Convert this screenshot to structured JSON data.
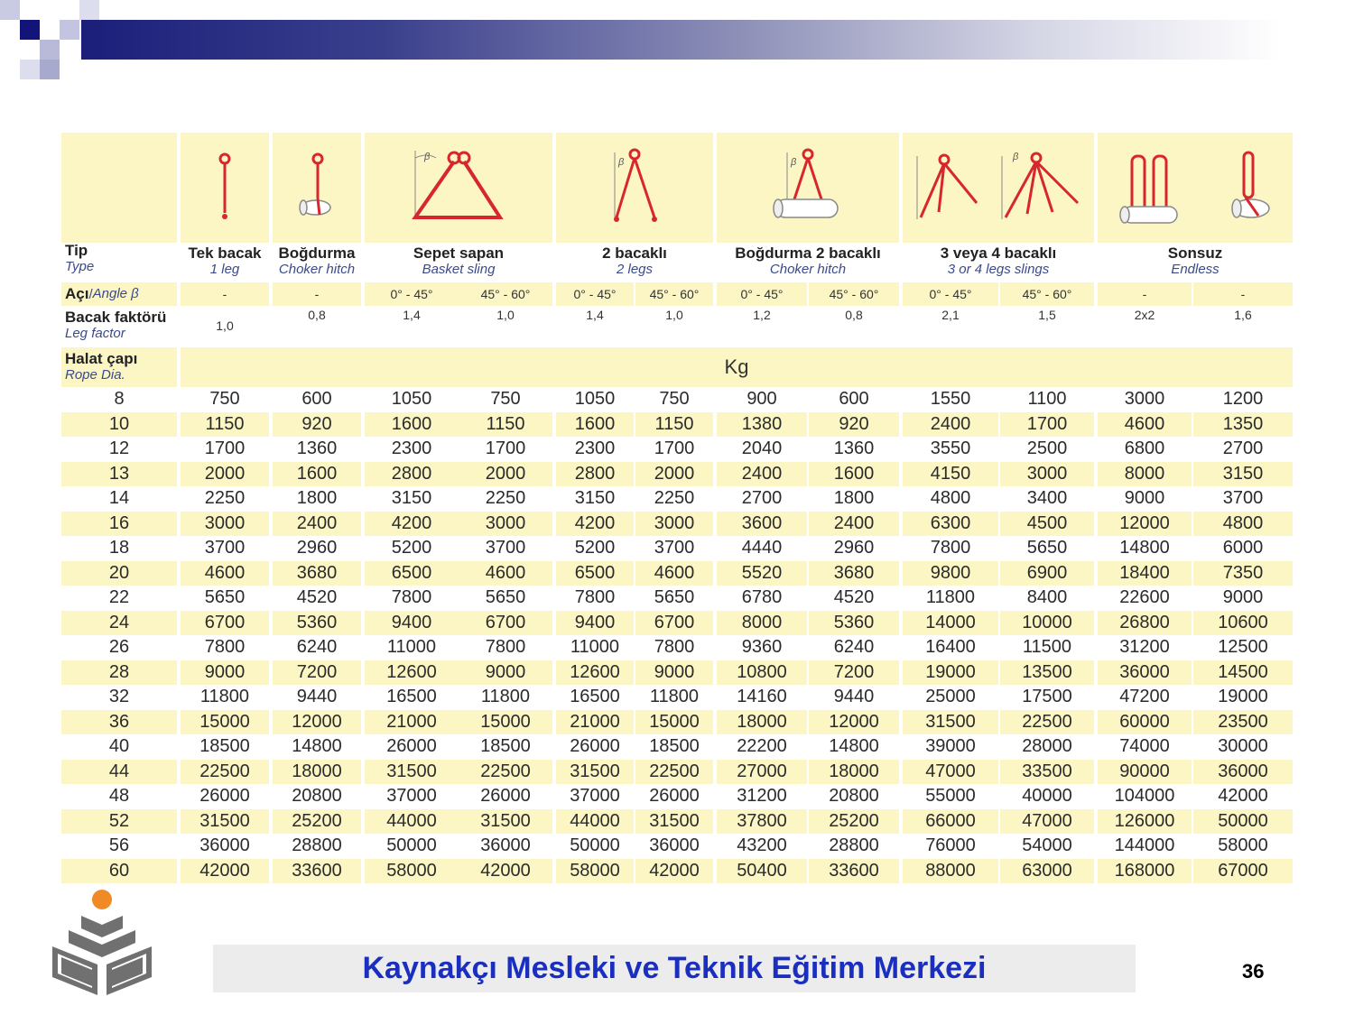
{
  "header": {
    "col_type": {
      "tr": "Tip",
      "en": "Type"
    },
    "angle_label": {
      "tr": "Açı",
      "en": "Angle β"
    },
    "leg_factor": {
      "tr": "Bacak faktörü",
      "en": "Leg factor"
    },
    "rope_dia": {
      "tr": "Halat çapı",
      "en": "Rope Dia."
    },
    "unit": "Kg",
    "groups": [
      {
        "tr": "Tek bacak",
        "en": "1 leg"
      },
      {
        "tr": "Boğdurma",
        "en": "Choker hitch"
      },
      {
        "tr": "Sepet sapan",
        "en": "Basket sling"
      },
      {
        "tr": "2 bacaklı",
        "en": "2 legs"
      },
      {
        "tr": "Boğdurma 2 bacaklı",
        "en": "Choker hitch"
      },
      {
        "tr": "3 veya 4 bacaklı",
        "en": "3 or 4 legs slings"
      },
      {
        "tr": "Sonsuz",
        "en": "Endless"
      }
    ],
    "angles": [
      "-",
      "-",
      "0° - 45°",
      "45° - 60°",
      "0° - 45°",
      "45° - 60°",
      "0° - 45°",
      "45° - 60°",
      "0° - 45°",
      "45° - 60°",
      "-",
      "-"
    ],
    "factors": [
      "1,0",
      "0,8",
      "1,4",
      "1,0",
      "1,4",
      "1,0",
      "1,2",
      "0,8",
      "2,1",
      "1,5",
      "2x2",
      "1,6"
    ],
    "beta_symbol": "β"
  },
  "rows": [
    [
      "8",
      "750",
      "600",
      "1050",
      "750",
      "1050",
      "750",
      "900",
      "600",
      "1550",
      "1100",
      "3000",
      "1200"
    ],
    [
      "10",
      "1150",
      "920",
      "1600",
      "1150",
      "1600",
      "1150",
      "1380",
      "920",
      "2400",
      "1700",
      "4600",
      "1350"
    ],
    [
      "12",
      "1700",
      "1360",
      "2300",
      "1700",
      "2300",
      "1700",
      "2040",
      "1360",
      "3550",
      "2500",
      "6800",
      "2700"
    ],
    [
      "13",
      "2000",
      "1600",
      "2800",
      "2000",
      "2800",
      "2000",
      "2400",
      "1600",
      "4150",
      "3000",
      "8000",
      "3150"
    ],
    [
      "14",
      "2250",
      "1800",
      "3150",
      "2250",
      "3150",
      "2250",
      "2700",
      "1800",
      "4800",
      "3400",
      "9000",
      "3700"
    ],
    [
      "16",
      "3000",
      "2400",
      "4200",
      "3000",
      "4200",
      "3000",
      "3600",
      "2400",
      "6300",
      "4500",
      "12000",
      "4800"
    ],
    [
      "18",
      "3700",
      "2960",
      "5200",
      "3700",
      "5200",
      "3700",
      "4440",
      "2960",
      "7800",
      "5650",
      "14800",
      "6000"
    ],
    [
      "20",
      "4600",
      "3680",
      "6500",
      "4600",
      "6500",
      "4600",
      "5520",
      "3680",
      "9800",
      "6900",
      "18400",
      "7350"
    ],
    [
      "22",
      "5650",
      "4520",
      "7800",
      "5650",
      "7800",
      "5650",
      "6780",
      "4520",
      "11800",
      "8400",
      "22600",
      "9000"
    ],
    [
      "24",
      "6700",
      "5360",
      "9400",
      "6700",
      "9400",
      "6700",
      "8000",
      "5360",
      "14000",
      "10000",
      "26800",
      "10600"
    ],
    [
      "26",
      "7800",
      "6240",
      "11000",
      "7800",
      "11000",
      "7800",
      "9360",
      "6240",
      "16400",
      "11500",
      "31200",
      "12500"
    ],
    [
      "28",
      "9000",
      "7200",
      "12600",
      "9000",
      "12600",
      "9000",
      "10800",
      "7200",
      "19000",
      "13500",
      "36000",
      "14500"
    ],
    [
      "32",
      "11800",
      "9440",
      "16500",
      "11800",
      "16500",
      "11800",
      "14160",
      "9440",
      "25000",
      "17500",
      "47200",
      "19000"
    ],
    [
      "36",
      "15000",
      "12000",
      "21000",
      "15000",
      "21000",
      "15000",
      "18000",
      "12000",
      "31500",
      "22500",
      "60000",
      "23500"
    ],
    [
      "40",
      "18500",
      "14800",
      "26000",
      "18500",
      "26000",
      "18500",
      "22200",
      "14800",
      "39000",
      "28000",
      "74000",
      "30000"
    ],
    [
      "44",
      "22500",
      "18000",
      "31500",
      "22500",
      "31500",
      "22500",
      "27000",
      "18000",
      "47000",
      "33500",
      "90000",
      "36000"
    ],
    [
      "48",
      "26000",
      "20800",
      "37000",
      "26000",
      "37000",
      "26000",
      "31200",
      "20800",
      "55000",
      "40000",
      "104000",
      "42000"
    ],
    [
      "52",
      "31500",
      "25200",
      "44000",
      "31500",
      "44000",
      "31500",
      "37800",
      "25200",
      "66000",
      "47000",
      "126000",
      "50000"
    ],
    [
      "56",
      "36000",
      "28800",
      "50000",
      "36000",
      "50000",
      "36000",
      "43200",
      "28800",
      "76000",
      "54000",
      "144000",
      "58000"
    ],
    [
      "60",
      "42000",
      "33600",
      "58000",
      "42000",
      "58000",
      "42000",
      "50400",
      "33600",
      "88000",
      "63000",
      "168000",
      "67000"
    ]
  ],
  "footer": {
    "title": "Kaynakçı Mesleki ve Teknik Eğitim Merkezi",
    "page": "36"
  },
  "colors": {
    "band_yellow": "#fbf6c4",
    "accent_red": "#d8262e",
    "title_blue": "#1a2fc0",
    "logo_orange": "#f08a24",
    "logo_gray": "#707070"
  },
  "icons": [
    "single-leg-sling-icon",
    "choker-hitch-icon",
    "basket-sling-icon",
    "two-leg-sling-icon",
    "choker-two-leg-icon",
    "three-leg-sling-icon",
    "four-leg-sling-icon",
    "endless-sling-icon",
    "endless-choker-icon",
    "institution-logo"
  ]
}
